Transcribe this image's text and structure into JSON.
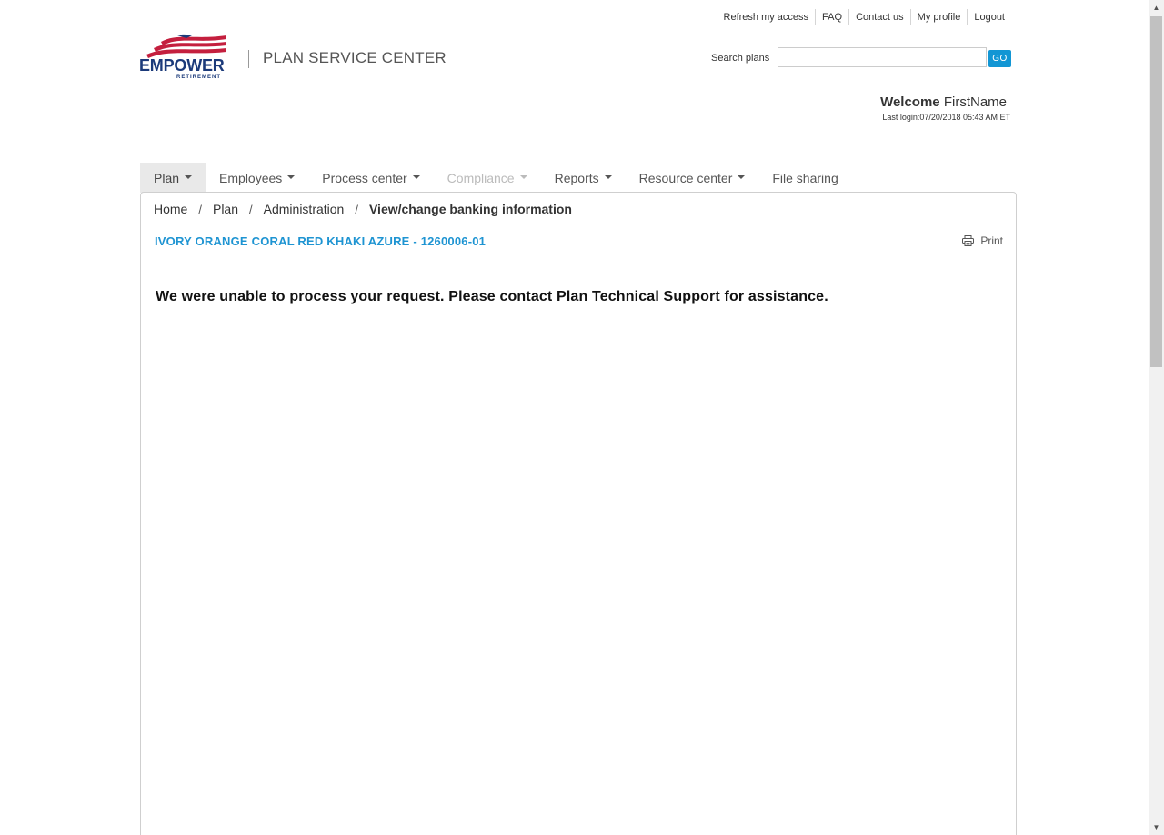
{
  "util_nav": {
    "items": [
      {
        "label": "Refresh my access"
      },
      {
        "label": "FAQ"
      },
      {
        "label": "Contact us"
      },
      {
        "label": "My profile"
      },
      {
        "label": "Logout"
      }
    ]
  },
  "logo": {
    "word": "EMPOWER",
    "sub": "RETIREMENT",
    "colors": {
      "red": "#c41f3e",
      "blue": "#1b3a7a"
    }
  },
  "site_title": "PLAN SERVICE CENTER",
  "search": {
    "label": "Search plans",
    "value": "",
    "placeholder": "",
    "go_label": "GO"
  },
  "welcome": {
    "greeting": "Welcome",
    "name": "FirstName",
    "last_login": "Last login:07/20/2018 05:43 AM ET"
  },
  "main_nav": [
    {
      "label": "Plan",
      "dropdown": true,
      "state": "active"
    },
    {
      "label": "Employees",
      "dropdown": true,
      "state": "normal"
    },
    {
      "label": "Process center",
      "dropdown": true,
      "state": "normal"
    },
    {
      "label": "Compliance",
      "dropdown": true,
      "state": "disabled"
    },
    {
      "label": "Reports",
      "dropdown": true,
      "state": "normal"
    },
    {
      "label": "Resource center",
      "dropdown": true,
      "state": "normal"
    },
    {
      "label": "File sharing",
      "dropdown": false,
      "state": "normal"
    }
  ],
  "breadcrumb": {
    "items": [
      "Home",
      "Plan",
      "Administration"
    ],
    "separator": "/",
    "current": "View/change banking information"
  },
  "plan_name": "IVORY ORANGE CORAL RED KHAKI AZURE - 1260006-01",
  "print_label": "Print",
  "error_message": "We were unable to process your request. Please contact Plan Technical Support for assistance.",
  "colors": {
    "accent": "#1e94d2",
    "go_button": "#1296d4",
    "nav_active_bg": "#e9e9e9"
  }
}
